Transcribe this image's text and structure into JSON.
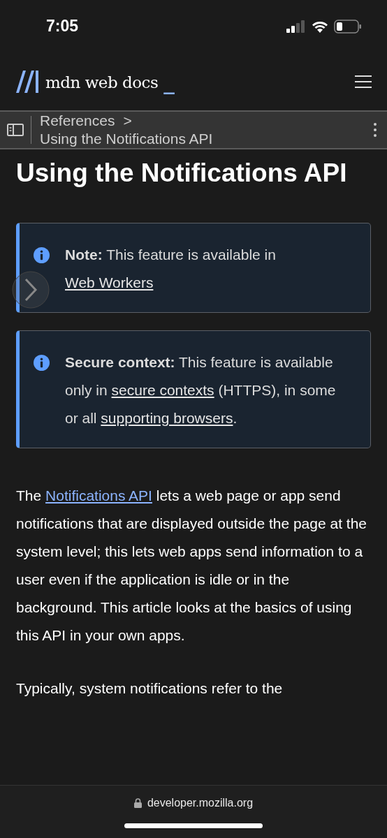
{
  "status_bar": {
    "time": "7:05"
  },
  "header": {
    "logo_text": "mdn web docs",
    "cursor": "_"
  },
  "breadcrumb": {
    "parent": "References",
    "separator": ">",
    "current": "Using the Notifications API"
  },
  "title": "Using the Notifications API",
  "callouts": [
    {
      "label": "Note:",
      "parts": [
        {
          "text": " This feature is available in "
        },
        {
          "link": "Web Workers"
        }
      ]
    },
    {
      "label": "Secure context:",
      "parts": [
        {
          "text": " This feature is available only in "
        },
        {
          "link": "secure contexts"
        },
        {
          "text": " (HTTPS), in some or all "
        },
        {
          "link": "supporting browsers"
        },
        {
          "text": "."
        }
      ]
    }
  ],
  "paragraphs": [
    {
      "parts": [
        {
          "text": "The "
        },
        {
          "link": "Notifications API"
        },
        {
          "text": " lets a web page or app send notifications that are displayed outside the page at the system level; this lets web apps send information to a user even if the application is idle or in the background. This article looks at the basics of using this API in your own apps."
        }
      ]
    },
    {
      "parts": [
        {
          "text": "Typically, system notifications refer to the"
        }
      ]
    }
  ],
  "address_bar": {
    "url": "developer.mozilla.org"
  }
}
